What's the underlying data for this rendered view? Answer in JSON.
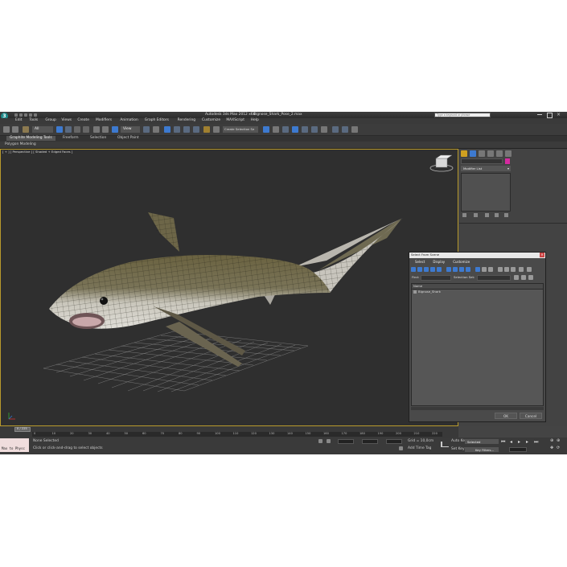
{
  "app": {
    "title": "Autodesk 3ds Max 2012 x64",
    "file": "Bignose_Shark_Pose_2.max",
    "search_placeholder": "Type a keyword or phrase",
    "logo": "3ds-max-logo"
  },
  "menu": [
    "Edit",
    "Tools",
    "Group",
    "Views",
    "Create",
    "Modifiers",
    "Animation",
    "Graph Editors",
    "Rendering",
    "Customize",
    "MAXScript",
    "Help"
  ],
  "toolbar": {
    "filter_value": "All",
    "refcoord_value": "View",
    "selection_set_placeholder": "Create Selection Se"
  },
  "ribbon": {
    "tabs": [
      "Graphite Modeling Tools",
      "Freeform",
      "Selection",
      "Object Paint"
    ],
    "sub_label": "Polygon Modeling"
  },
  "viewport": {
    "label": "[ + ] [ Perspective ] [ Shaded + Edged Faces ]"
  },
  "command_panel": {
    "modifier_list_label": "Modifier List"
  },
  "select_dialog": {
    "title": "Select From Scene",
    "menu": [
      "Select",
      "Display",
      "Customize"
    ],
    "find_label": "Find:",
    "selection_set_label": "Selection Set:",
    "column_header": "Name",
    "items": [
      "Bignose_Shark"
    ],
    "ok_label": "OK",
    "cancel_label": "Cancel"
  },
  "timeline": {
    "frame_indicator": "0 / 225",
    "ticks": [
      "0",
      "10",
      "20",
      "30",
      "40",
      "50",
      "60",
      "70",
      "80",
      "90",
      "100",
      "110",
      "120",
      "130",
      "140",
      "150",
      "160",
      "170",
      "180",
      "190",
      "200",
      "210",
      "220"
    ]
  },
  "status": {
    "maxscript_text": "Max to Physc",
    "selection_status": "None Selected",
    "prompt": "Click or click-and-drag to select objects",
    "grid": "Grid = 10,0cm",
    "add_time_tag": "Add Time Tag",
    "auto_key": "Auto Key",
    "auto_key_value": "Selected",
    "set_key": "Set Key",
    "key_filters": "Key Filters..."
  }
}
